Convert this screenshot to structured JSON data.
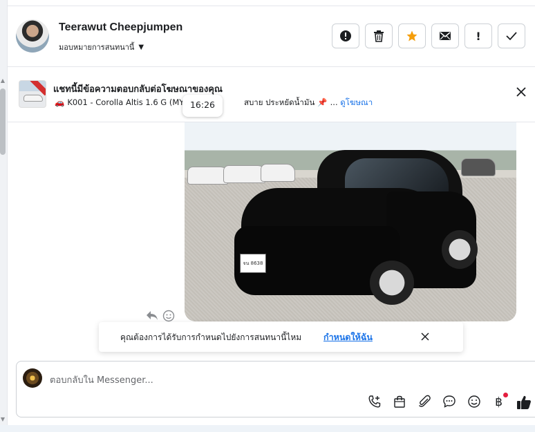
{
  "header": {
    "contact_name": "Teerawut Cheepjumpen",
    "assign_label": "มอบหมายการสนทนานี้",
    "actions": [
      {
        "name": "report-button",
        "icon": "alert-circle-icon",
        "glyph": "❗"
      },
      {
        "name": "delete-button",
        "icon": "trash-icon",
        "glyph": "🗑"
      },
      {
        "name": "star-button",
        "icon": "star-icon",
        "glyph": "★"
      },
      {
        "name": "mark-unread-button",
        "icon": "envelope-icon",
        "glyph": "✉"
      },
      {
        "name": "follow-up-button",
        "icon": "exclamation-icon",
        "glyph": "!"
      },
      {
        "name": "done-button",
        "icon": "check-icon",
        "glyph": "✓"
      }
    ]
  },
  "banner": {
    "title": "แชทนี้มีข้อความตอบกลับต่อโฆษณาของคุณ",
    "subtitle_prefix": "K001 - Corolla Altis 1.6 G (MY14",
    "subtitle_suffix": "สบาย ประหยัดน้ำมัน",
    "ellipsis": "...",
    "link": "ดูโฆษณา"
  },
  "message": {
    "timestamp": "16:26",
    "plate_text": "จน 8638"
  },
  "toast": {
    "text": "คุณต้องการได้รับการกำหนดไปยังการสนทนานี้ไหม",
    "link": "กำหนดให้ฉัน"
  },
  "composer": {
    "placeholder": "ตอบกลับใน Messenger...",
    "tools": [
      {
        "name": "call-button",
        "icon": "phone-plus-icon",
        "glyph": "📞"
      },
      {
        "name": "shop-button",
        "icon": "shopping-bag-icon",
        "glyph": "🛍"
      },
      {
        "name": "attach-button",
        "icon": "paperclip-icon",
        "glyph": "📎"
      },
      {
        "name": "saved-reply-button",
        "icon": "chat-bubble-icon",
        "glyph": "💬"
      },
      {
        "name": "emoji-button",
        "icon": "smiley-icon",
        "glyph": "☺"
      },
      {
        "name": "payment-button",
        "icon": "baht-icon",
        "glyph": "฿"
      },
      {
        "name": "like-button",
        "icon": "thumbs-up-icon",
        "glyph": "👍"
      }
    ]
  },
  "colors": {
    "link": "#1a73e8",
    "star": "#f59e0b",
    "notification_dot": "#e41e3f"
  }
}
